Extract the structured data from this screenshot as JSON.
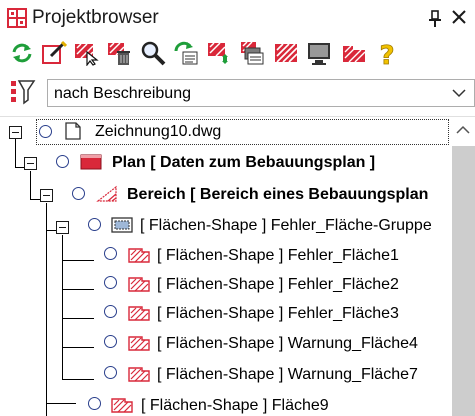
{
  "window": {
    "title": "Projektbrowser",
    "icons": [
      "grid-panel-icon",
      "pin-icon",
      "close-icon"
    ]
  },
  "toolbar": {
    "buttons": [
      {
        "name": "refresh-button",
        "icon": "refresh-icon"
      },
      {
        "name": "edit-button",
        "icon": "edit-icon"
      },
      {
        "name": "select-layer-button",
        "icon": "select-cursor-icon"
      },
      {
        "name": "delete-button",
        "icon": "delete-icon"
      },
      {
        "name": "search-button",
        "icon": "search-icon"
      },
      {
        "name": "update-button",
        "icon": "update-icon"
      },
      {
        "name": "move-button",
        "icon": "move-icon"
      },
      {
        "name": "layers-button",
        "icon": "layers-icon"
      },
      {
        "name": "hatch-button",
        "icon": "hatch-icon"
      },
      {
        "name": "display-button",
        "icon": "monitor-icon"
      },
      {
        "name": "shape-button",
        "icon": "shape-icon"
      },
      {
        "name": "help-button",
        "icon": "help-icon"
      }
    ]
  },
  "filter": {
    "selected": "nach Beschreibung"
  },
  "tree": {
    "nodes": [
      {
        "label": "Zeichnung10.dwg",
        "icon": "document-icon",
        "bold": false,
        "level": 0
      },
      {
        "label": "Plan [ Daten zum Bebauungsplan ]",
        "icon": "plan-icon",
        "bold": true,
        "level": 1
      },
      {
        "label": "Bereich [ Bereich eines Bebauungsplan",
        "icon": "area-icon",
        "bold": true,
        "level": 2
      },
      {
        "label": "[ Flächen-Shape ] Fehler_Fläche-Gruppe",
        "icon": "group-shape-icon",
        "bold": false,
        "level": 3
      },
      {
        "label": "[ Flächen-Shape ] Fehler_Fläche1",
        "icon": "hatched-shape-icon",
        "bold": false,
        "level": 4
      },
      {
        "label": "[ Flächen-Shape ] Fehler_Fläche2",
        "icon": "hatched-shape-icon",
        "bold": false,
        "level": 4
      },
      {
        "label": "[ Flächen-Shape ] Fehler_Fläche3",
        "icon": "hatched-shape-icon",
        "bold": false,
        "level": 4
      },
      {
        "label": "[ Flächen-Shape ] Warnung_Fläche4",
        "icon": "hatched-shape-icon",
        "bold": false,
        "level": 4
      },
      {
        "label": "[ Flächen-Shape ] Warnung_Fläche7",
        "icon": "hatched-shape-icon",
        "bold": false,
        "level": 4
      },
      {
        "label": "[ Flächen-Shape ] Fläche9",
        "icon": "hatched-shape-icon",
        "bold": false,
        "level": 3
      }
    ]
  },
  "colors": {
    "accent_red": "#d9283a",
    "accent_green": "#1f9e3a",
    "radio_blue": "#2a3f8c"
  }
}
